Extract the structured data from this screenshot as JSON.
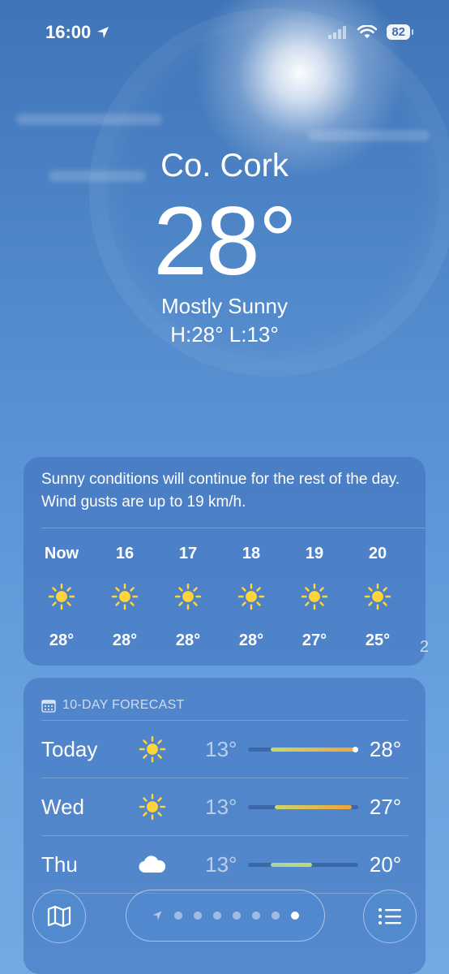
{
  "status_bar": {
    "time": "16:00",
    "battery": "82"
  },
  "location": {
    "city": "Co. Cork",
    "temperature": "28°",
    "condition": "Mostly Sunny",
    "high_low": "H:28°  L:13°"
  },
  "hourly": {
    "summary": "Sunny conditions will continue for the rest of the day. Wind gusts are up to 19 km/h.",
    "items": [
      {
        "label": "Now",
        "temp": "28°",
        "icon": "sun-icon"
      },
      {
        "label": "16",
        "temp": "28°",
        "icon": "sun-icon"
      },
      {
        "label": "17",
        "temp": "28°",
        "icon": "sun-icon"
      },
      {
        "label": "18",
        "temp": "28°",
        "icon": "sun-icon"
      },
      {
        "label": "19",
        "temp": "27°",
        "icon": "sun-icon"
      },
      {
        "label": "20",
        "temp": "25°",
        "icon": "sun-icon"
      }
    ],
    "peek": "2"
  },
  "daily": {
    "title": "10-DAY FORECAST",
    "days": [
      {
        "day": "Today",
        "icon": "sun-icon",
        "low": "13°",
        "high": "28°",
        "range_start": 0.2,
        "range_end": 1.0,
        "current": 1.0
      },
      {
        "day": "Wed",
        "icon": "sun-icon",
        "low": "13°",
        "high": "27°",
        "range_start": 0.24,
        "range_end": 0.94
      },
      {
        "day": "Thu",
        "icon": "cloud-icon",
        "low": "13°",
        "high": "20°",
        "range_start": 0.2,
        "range_end": 0.58
      }
    ]
  },
  "pager": {
    "page_count": 7,
    "active_index": 6
  },
  "colors": {
    "sun": "#FFD43B",
    "bar_warm": "#F0A23A",
    "bar_mild": "#C9D86A",
    "bar_cool": "#9FD6B0"
  }
}
